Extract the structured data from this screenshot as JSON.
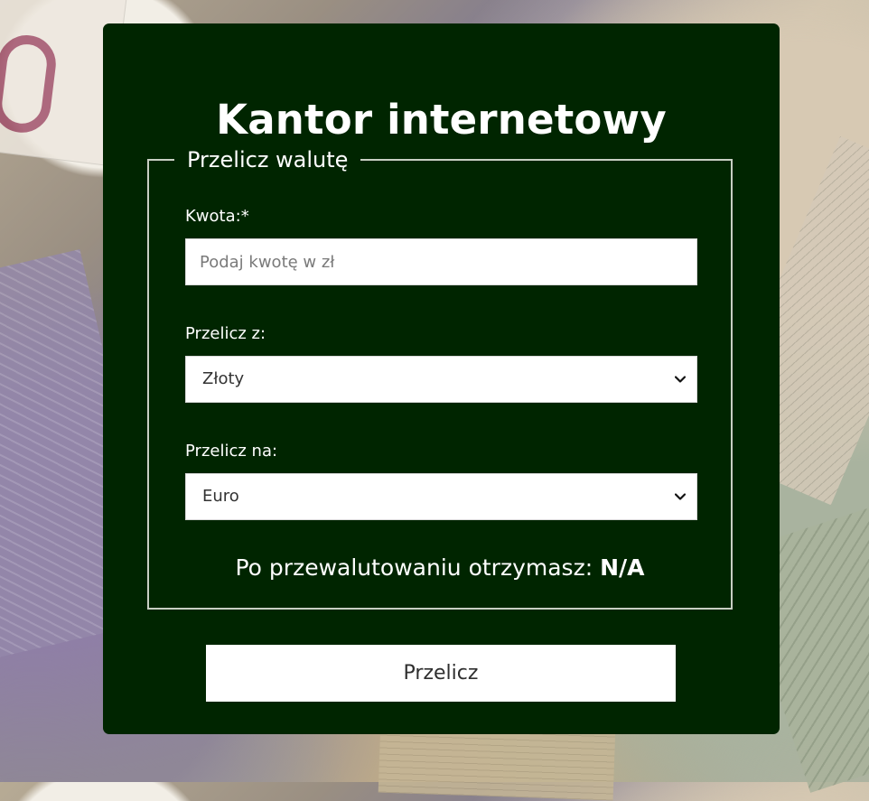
{
  "page": {
    "title": "Kantor internetowy"
  },
  "form": {
    "legend": "Przelicz walutę",
    "amount_label": "Kwota:*",
    "amount_placeholder": "Podaj kwotę w zł",
    "amount_value": "",
    "from_label": "Przelicz z:",
    "from_value": "Złoty",
    "to_label": "Przelicz na:",
    "to_value": "Euro",
    "result_label": "Po przewalutowaniu otrzymasz:",
    "result_value": "N/A",
    "button_label": "Przelicz"
  },
  "colors": {
    "card_background": "#002500",
    "text": "#ffffff",
    "input_background": "#ffffff"
  },
  "icons": {
    "from_select": "chevron-down-icon",
    "to_select": "chevron-down-icon"
  }
}
